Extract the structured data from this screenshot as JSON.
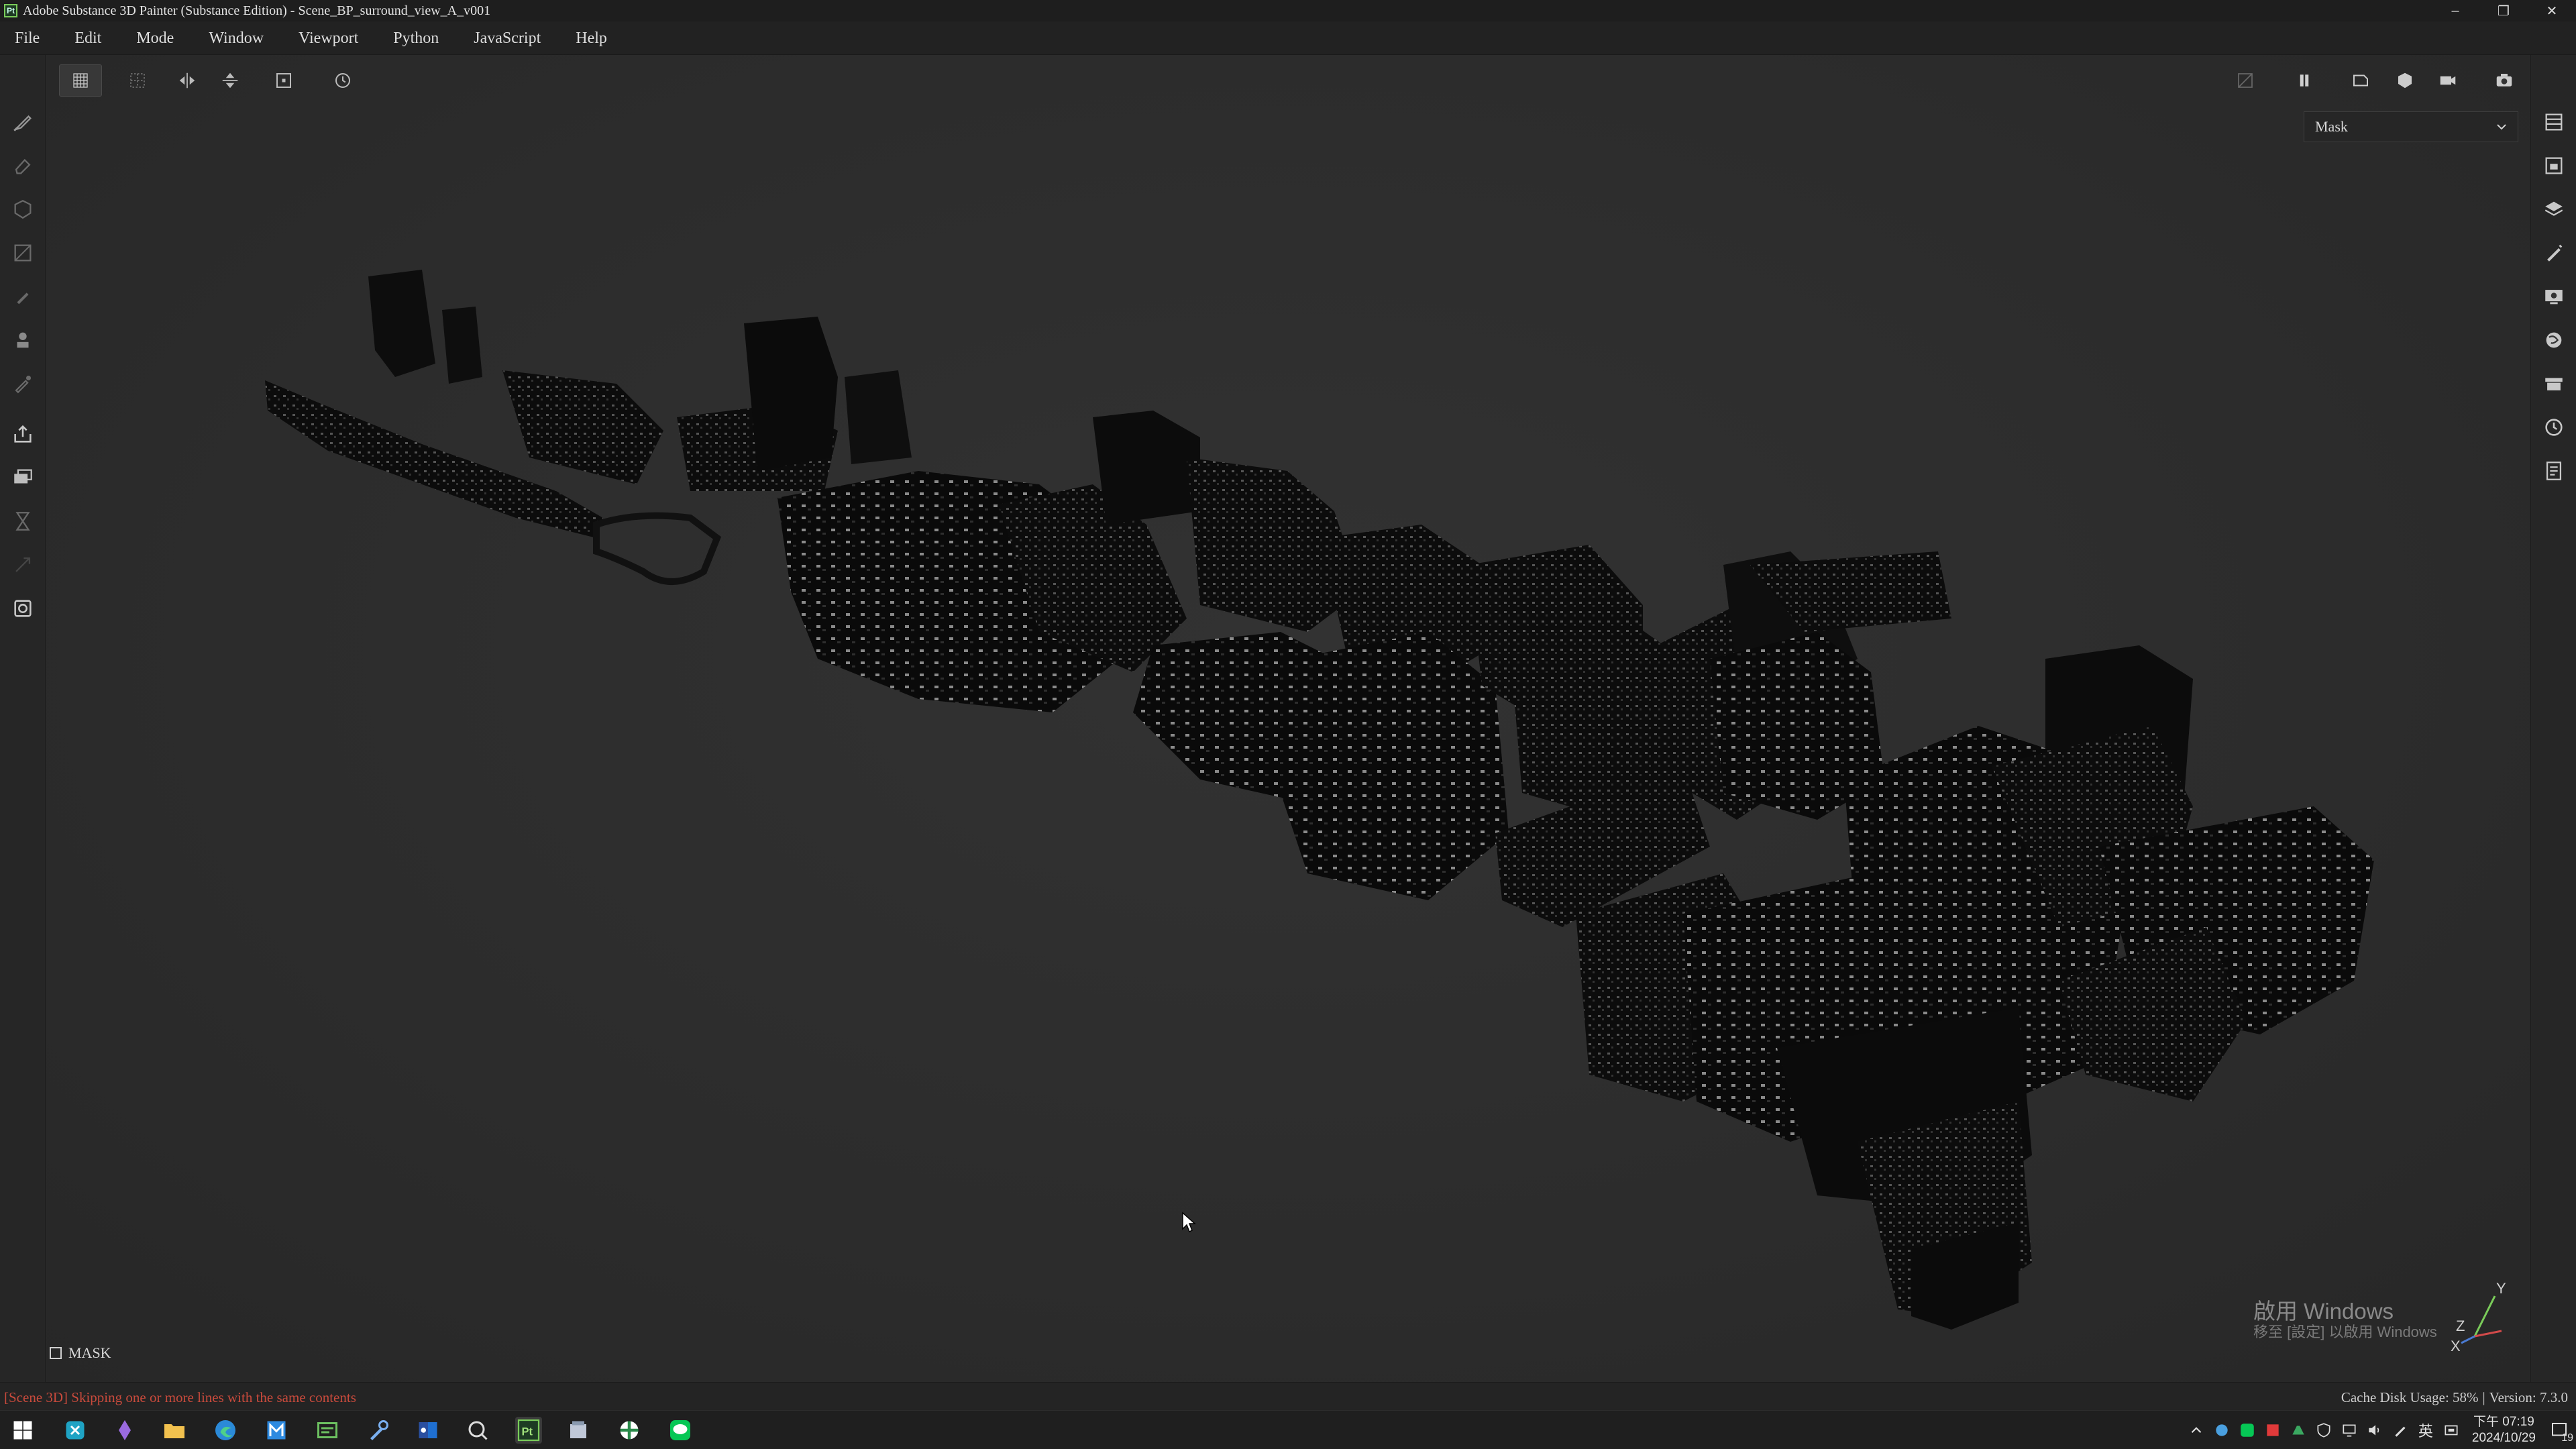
{
  "window": {
    "title": "Adobe Substance 3D Painter (Substance Edition) - Scene_BP_surround_view_A_v001",
    "minimize": "–",
    "restore": "❐",
    "close": "✕"
  },
  "menu": {
    "items": [
      "File",
      "Edit",
      "Mode",
      "Window",
      "Viewport",
      "Python",
      "JavaScript",
      "Help"
    ]
  },
  "left_toolbar": {
    "icons": [
      "paint-brush-icon",
      "eraser-icon",
      "projection-icon",
      "polygon-fill-icon",
      "smudge-icon",
      "clone-icon",
      "color-picker-icon",
      "export-icon",
      "bake-icon",
      "hourglass-icon",
      "transform-icon",
      "screenshot-icon"
    ]
  },
  "viewport": {
    "toolbar_icons": [
      "grid-view-icon",
      "symmetry-grid-icon",
      "mirror-horizontal-icon",
      "mirror-vertical-icon",
      "frame-object-icon",
      "history-reset-icon"
    ],
    "right_toolbar_icons": [
      "hide-overlay-icon",
      "pause-icon",
      "shape-mode-icon",
      "object-mode-icon",
      "camera-icon",
      "screenshot-icon"
    ],
    "channel_select": {
      "value": "Mask"
    },
    "mask_label": "MASK",
    "accent": "#7acc5a"
  },
  "right_toolbar": {
    "icons": [
      "layers-icon",
      "texture-set-icon",
      "layer-stack-icon",
      "brush-settings-icon",
      "display-settings-icon",
      "environment-icon",
      "shelf-icon",
      "history-icon",
      "log-icon"
    ]
  },
  "watermark": {
    "title": "啟用 Windows",
    "subtitle": "移至 [設定] 以啟用 Windows"
  },
  "status": {
    "message": "[Scene 3D] Skipping one or more lines with the same contents",
    "cache": "Cache Disk Usage:  58%",
    "separator": "|",
    "version": "Version: 7.3.0",
    "message_color": "#c84a3c"
  },
  "taskbar": {
    "apps": [
      "windows-start-icon",
      "app-teal-icon",
      "app-purple-icon",
      "file-explorer-icon",
      "edge-icon",
      "app-blue-m-icon",
      "app-green-icon",
      "app-tool-icon",
      "outlook-icon",
      "search-app-icon",
      "painter-icon",
      "app-files-icon",
      "app-hub-icon",
      "line-icon"
    ],
    "clock_time": "下午 07:19",
    "clock_date": "2024/10/29",
    "ime": "英",
    "notifications": "19"
  }
}
